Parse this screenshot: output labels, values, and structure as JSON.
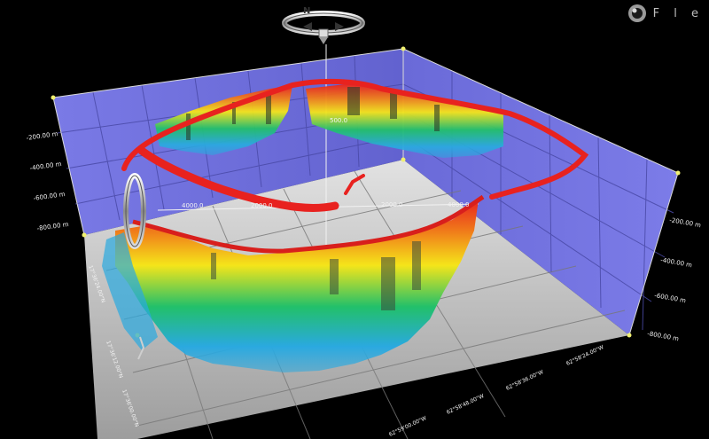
{
  "app": {
    "brand_text": "F l e"
  },
  "compass": {
    "north_label": "N"
  },
  "walls": {
    "left_depth_labels": [
      "-200.00 m",
      "-400.00 m",
      "-600.00 m",
      "-800.00 m"
    ],
    "right_depth_labels": [
      "-200.00 m",
      "-400.00 m",
      "-600.00 m",
      "-800.00 m"
    ]
  },
  "floor": {
    "distance_labels": [
      "4000.0",
      "2000.0",
      "2000.0",
      "4000.0"
    ],
    "vertical_label": "500.0",
    "latitude_labels": [
      "17°36'00.00\"N",
      "17°36'12.00\"N",
      "17°36'24.00\"N"
    ],
    "longitude_labels": [
      "62°58'48.00\"W",
      "62°58'36.00\"W",
      "62°58'24.00\"W",
      "62°59'00.00\"W"
    ]
  },
  "colors": {
    "wall": "#6b6bd6",
    "floor": "#b5b5b5",
    "surface_top": "#e8221f",
    "surface_mid": "#f5e51a",
    "surface_low": "#22c06a",
    "surface_deep": "#2aa9e0"
  }
}
